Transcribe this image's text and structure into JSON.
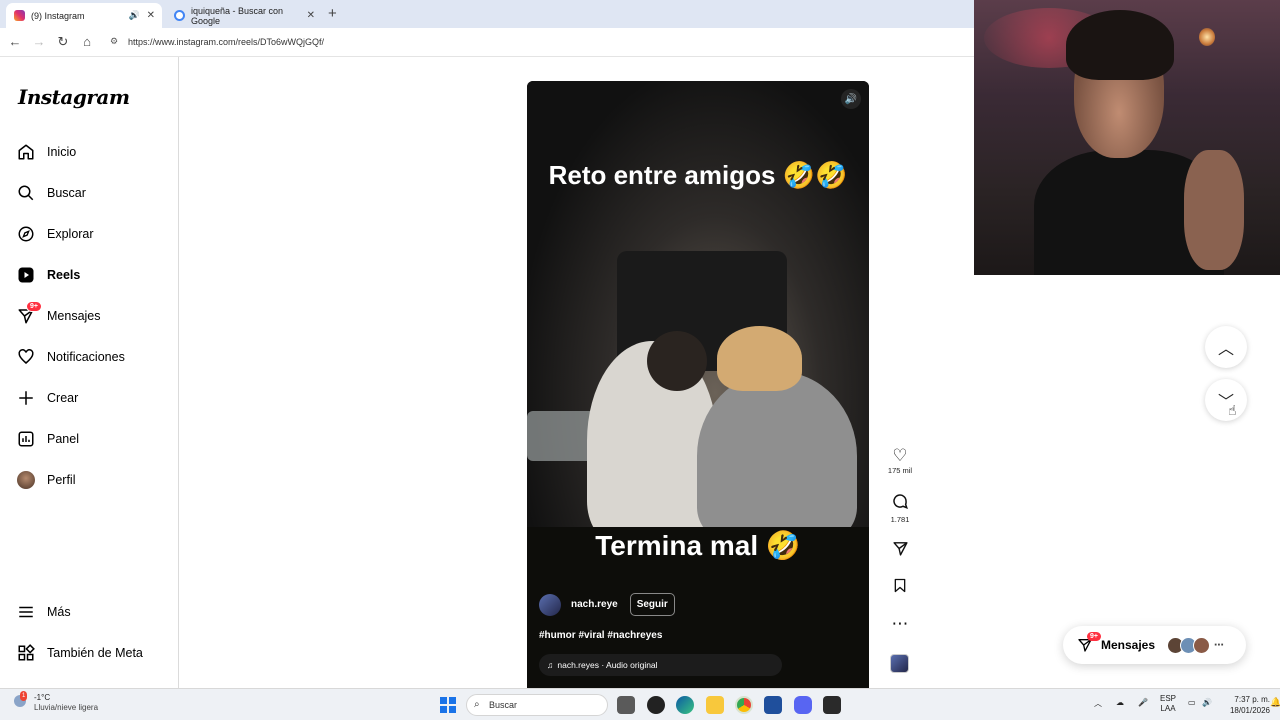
{
  "browser": {
    "tabs": [
      {
        "title": "(9) Instagram",
        "active": true
      },
      {
        "title": "iquiqueña - Buscar con Google",
        "active": false
      }
    ],
    "url": "https://www.instagram.com/reels/DTo6wWQjGQf/"
  },
  "sidebar": {
    "logo": "Instagram",
    "items": [
      {
        "label": "Inicio",
        "icon": "home-icon"
      },
      {
        "label": "Buscar",
        "icon": "search-icon"
      },
      {
        "label": "Explorar",
        "icon": "compass-icon"
      },
      {
        "label": "Reels",
        "icon": "reels-icon"
      },
      {
        "label": "Mensajes",
        "icon": "messenger-icon",
        "badge": "9+"
      },
      {
        "label": "Notificaciones",
        "icon": "heart-icon"
      },
      {
        "label": "Crear",
        "icon": "plus-icon"
      },
      {
        "label": "Panel",
        "icon": "chart-icon"
      },
      {
        "label": "Perfil",
        "icon": "avatar"
      }
    ],
    "bottom": [
      {
        "label": "Más",
        "icon": "menu-icon"
      },
      {
        "label": "También de Meta",
        "icon": "meta-icon"
      }
    ]
  },
  "reel": {
    "caption_top": "Reto entre amigos 🤣🤣",
    "caption_bottom": "Termina mal 🤣",
    "username": "nach.reye",
    "follow_label": "Seguir",
    "hashtags": "#humor #viral #nachreyes",
    "audio": "nach.reyes · Audio original",
    "likes": "175 mil",
    "comments": "1.781"
  },
  "messages_pill": {
    "label": "Mensajes",
    "badge": "9+"
  },
  "taskbar": {
    "weather_temp": "-1°C",
    "weather_desc": "Lluvia/nieve ligera",
    "weather_badge": "1",
    "search_placeholder": "Buscar",
    "lang_top": "ESP",
    "lang_bottom": "LAA",
    "time": "7:37 p. m.",
    "date": "18/01/2026"
  },
  "colors": {
    "accent_badge": "#ff3040",
    "win_blue": "#1a73e8"
  }
}
